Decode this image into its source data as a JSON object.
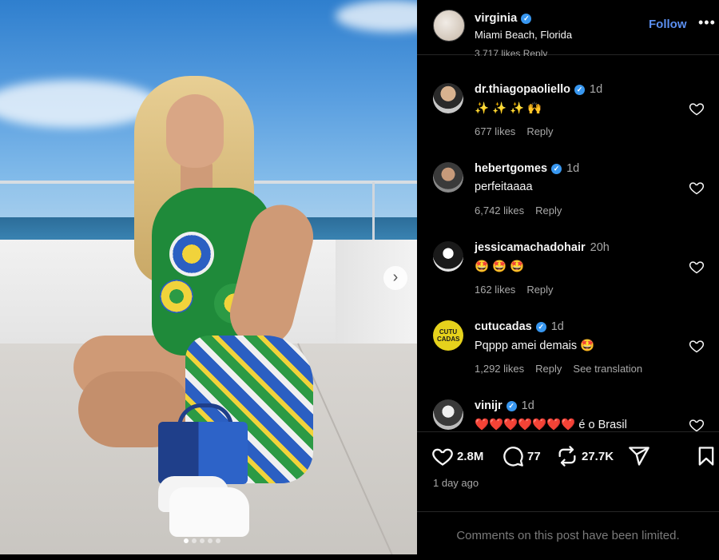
{
  "post": {
    "username": "virginia",
    "location": "Miami Beach, Florida",
    "follow_label": "Follow",
    "more_label": "•••",
    "verified_icon": "verified-badge-icon",
    "cut_text": "3,717 likes    Reply"
  },
  "comments": [
    {
      "username": "dr.thiagopaoliello",
      "verified": true,
      "time": "1d",
      "text": "✨ ✨ ✨ 🙌",
      "likes": "677 likes",
      "reply": "Reply",
      "translate": ""
    },
    {
      "username": "hebertgomes",
      "verified": true,
      "time": "1d",
      "text": "perfeitaaaa",
      "likes": "6,742 likes",
      "reply": "Reply",
      "translate": ""
    },
    {
      "username": "jessicamachadohair",
      "verified": false,
      "time": "20h",
      "text": "🤩 🤩 🤩",
      "likes": "162 likes",
      "reply": "Reply",
      "translate": ""
    },
    {
      "username": "cutucadas",
      "verified": true,
      "time": "1d",
      "text": "Pqppp amei demais 🤩",
      "likes": "1,292 likes",
      "reply": "Reply",
      "translate": "See translation"
    },
    {
      "username": "vinijr",
      "verified": true,
      "time": "1d",
      "text": "❤️❤️❤️❤️❤️❤️❤️ é o Brasil",
      "likes": "",
      "reply": "",
      "translate": ""
    }
  ],
  "avatar_labels": {
    "cutucadas": "CUTU CADAS"
  },
  "actions": {
    "likes": "2.8M",
    "comments": "77",
    "reposts": "27.7K",
    "date": "1 day ago",
    "limited_notice": "Comments on this post have been limited."
  },
  "carousel": {
    "next_icon": "chevron-right-icon",
    "dots": 5,
    "active_dot": 1
  },
  "colors": {
    "accent": "#5b8ff0",
    "verified": "#3897f0",
    "background": "#000000",
    "muted": "#a8a8a8"
  }
}
